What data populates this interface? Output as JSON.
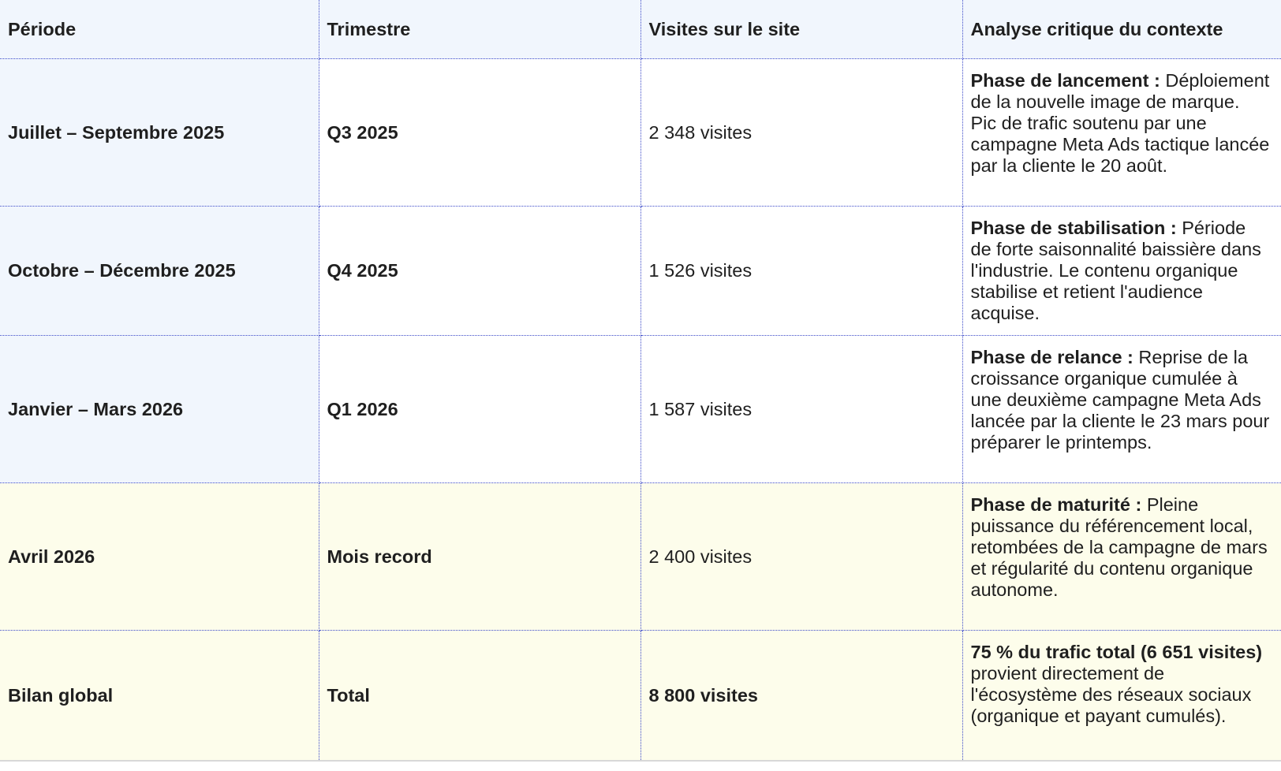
{
  "table": {
    "headers": [
      "Période",
      "Trimestre",
      "Visites sur le site",
      "Analyse critique du contexte"
    ],
    "rows": [
      {
        "periode": "Juillet – Septembre 2025",
        "trimestre": "Q3 2025",
        "visites": "2 348 visites",
        "analyse_bold": "Phase de lancement :",
        "analyse_text": " Déploiement de la nouvelle image de marque. Pic de trafic soutenu par une campagne Meta Ads tactique lancée par la cliente le 20 août."
      },
      {
        "periode": "Octobre – Décembre 2025",
        "trimestre": "Q4 2025",
        "visites": "1 526 visites",
        "analyse_bold": "Phase de stabilisation :",
        "analyse_text": " Période de forte saisonnalité baissière dans l'industrie. Le contenu organique stabilise et retient l'audience acquise."
      },
      {
        "periode": "Janvier – Mars 2026",
        "trimestre": "Q1 2026",
        "visites": "1 587 visites",
        "analyse_bold": "Phase de relance :",
        "analyse_text": " Reprise de la croissance organique cumulée à une deuxième campagne Meta Ads lancée par la cliente le 23 mars pour préparer le printemps."
      },
      {
        "periode": "Avril 2026",
        "trimestre": "Mois record",
        "visites": "2 400 visites",
        "analyse_bold": "Phase de maturité :",
        "analyse_text": " Pleine puissance du référencement local, retombées de la campagne de mars et régularité du contenu organique autonome."
      },
      {
        "periode": "Bilan global",
        "trimestre": "Total",
        "visites": "8 800 visites",
        "analyse_bold": "75 % du trafic total (6 651 visites)",
        "analyse_text": " provient directement de l'écosystème des réseaux sociaux (organique et payant cumulés)."
      }
    ]
  },
  "colors": {
    "header_bg": "#f1f6fd",
    "label_col_bg": "#f1f6fd",
    "highlight_bg": "#fdfdeb",
    "border": "#3b49c9",
    "text": "#1f1f1f"
  }
}
